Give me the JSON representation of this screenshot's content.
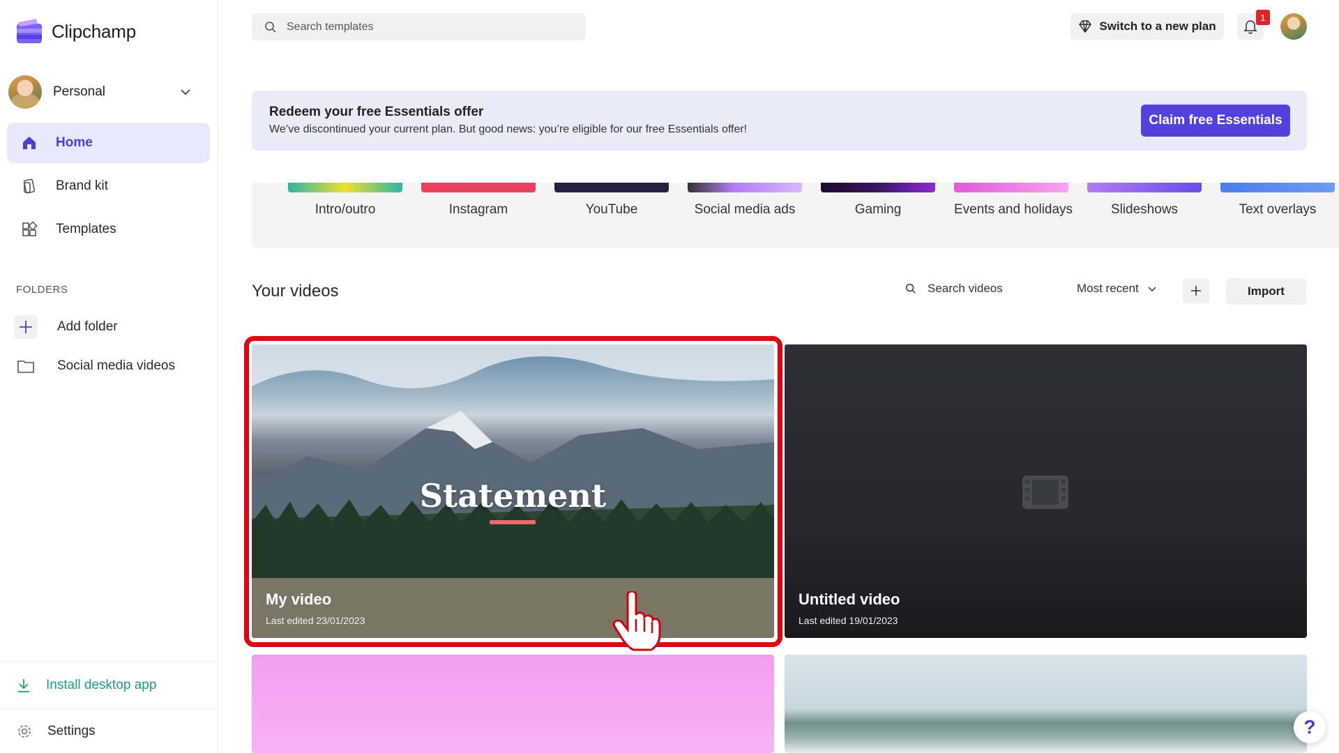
{
  "app": {
    "name": "Clipchamp"
  },
  "account": {
    "name": "Personal"
  },
  "nav": [
    {
      "label": "Home",
      "icon": "home-icon",
      "active": true
    },
    {
      "label": "Brand kit",
      "icon": "brand-kit-icon",
      "active": false
    },
    {
      "label": "Templates",
      "icon": "templates-icon",
      "active": false
    }
  ],
  "folders": {
    "heading": "FOLDERS",
    "add_label": "Add folder",
    "items": [
      {
        "label": "Social media videos"
      }
    ]
  },
  "sidebar_bottom": {
    "install_label": "Install desktop app",
    "settings_label": "Settings"
  },
  "topbar": {
    "search_placeholder": "Search templates",
    "switch_plan_label": "Switch to a new plan",
    "notification_count": "1"
  },
  "banner": {
    "title": "Redeem your free Essentials offer",
    "subtitle": "We’ve discontinued your current plan. But good news: you’re eligible for our free Essentials offer!",
    "button_label": "Claim free Essentials"
  },
  "categories": [
    {
      "label": "Intro/outro",
      "color": "#2bb5a6"
    },
    {
      "label": "Instagram",
      "color": "#e8405f"
    },
    {
      "label": "YouTube",
      "color": "#25223f"
    },
    {
      "label": "Social media ads",
      "color": "#b27cf0"
    },
    {
      "label": "Gaming",
      "color": "#3a1660"
    },
    {
      "label": "Events and holidays",
      "color": "#e05ad8"
    },
    {
      "label": "Slideshows",
      "color": "#8a5ce8"
    },
    {
      "label": "Text overlays",
      "color": "#4a7de8"
    }
  ],
  "your_videos": {
    "title": "Your videos",
    "search_placeholder": "Search videos",
    "sort_label": "Most recent",
    "import_label": "Import"
  },
  "videos": [
    {
      "title": "My video",
      "date": "Last edited 23/01/2023",
      "overlay_text": "Statement"
    },
    {
      "title": "Untitled video",
      "date": "Last edited 19/01/2023"
    }
  ],
  "colors": {
    "accent": "#5340dd",
    "highlight": "#e3000f",
    "install": "#1aa37a"
  }
}
